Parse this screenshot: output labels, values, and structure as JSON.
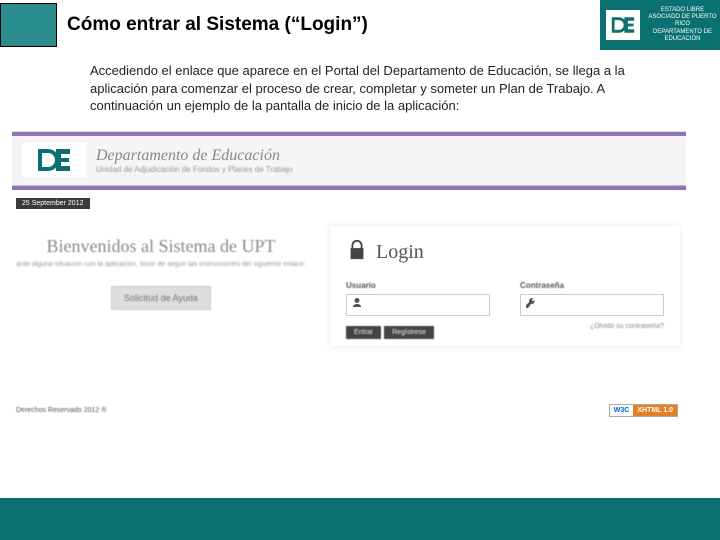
{
  "header": {
    "title": "Cómo entrar al Sistema (“Login”)",
    "logo_line1": "ESTADO LIBRE ASOCIADO DE PUERTO RICO",
    "logo_line2": "DEPARTAMENTO DE EDUCACIÓN"
  },
  "intro": "Accediendo el enlace que aparece en el Portal del Departamento de Educación, se llega a la aplicación para comenzar el proceso de crear, completar y someter un Plan de Trabajo.  A continuación un ejemplo de la pantalla de inicio de la aplicación:",
  "screenshot": {
    "dept_main": "Departamento de Educación",
    "dept_sub": "Unidad de Adjudicación de Fondos y Planes de Trabajo",
    "date": "25 September 2012",
    "welcome": "Bienvenidos al Sistema de UPT",
    "welcome_sub": "ante alguna situación con la aplicación, favor de seguir las instrucciones del siguiente enlace:",
    "help_btn": "Solicitud de Ayuda",
    "login_title": "Login",
    "user_label": "Usuario",
    "pass_label": "Contraseña",
    "enter_btn": "Entrar",
    "register_btn": "Regístrese",
    "forgot": "¿Olvidó su contraseña?",
    "copyright": "Derechos Reservado 2012 ®",
    "w3c_left": "W3C",
    "w3c_right": "XHTML 1.0"
  }
}
